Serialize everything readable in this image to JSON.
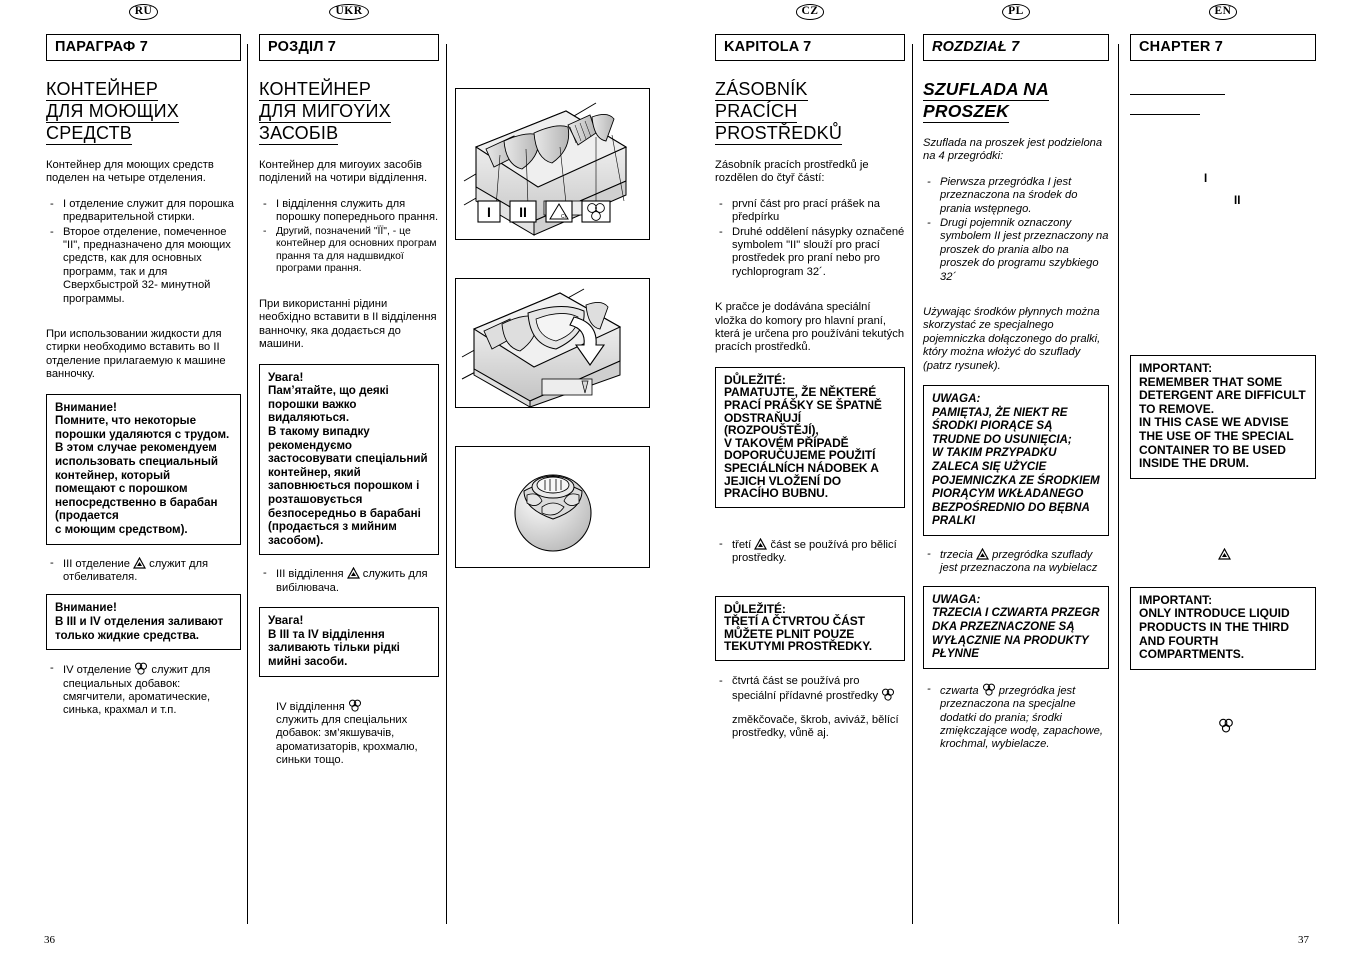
{
  "page": {
    "left_number": "36",
    "right_number": "37"
  },
  "columns": {
    "ru": {
      "flag": "RU",
      "chapter": "ПАРАГРАФ 7",
      "title_lines": [
        "КОНТЕЙНЕР",
        "ДЛЯ МОЮЩИХ",
        "СРЕДСТВ"
      ],
      "intro": "Контейнер для моющих средств поделен на четыре отделения.",
      "bullets": [
        "I отделение служит для порошка предварительной стирки.",
        "Второе отделение, помеченное \"II\", предназначено для моющих средств, как для основных программ, так и для Сверхбыстрой 32- минутной программы."
      ],
      "liquid_note": "При использовании жидкости для стирки необходимо вставить во II отделение прилагаемую к машине ванночку.",
      "warning1": "Внимание!\nПомните, что некоторые порошки удаляются с трудом.\nВ этом случае рекомендуем использовать специальный контейнер, который помещают с  порошком непосредственно в барабан (продается\nс моющим средством).",
      "bleach_bullet_pre": "III отделение",
      "bleach_bullet_post": "служит для отбеливателя.",
      "warning2": "Внимание!\nВ III и IV отделения заливают только жидкие средства.",
      "softener_bullet_pre": "IV отделение",
      "softener_bullet_post": "служит для специальных добавок: смягчители, ароматические, синька, крахмал и т.п."
    },
    "ukr": {
      "flag": "UKR",
      "chapter": "РОЗДІЛ 7",
      "title_lines": [
        "КОНТЕЙНЕР",
        "ДЛЯ МИГОYИХ",
        "ЗАСОБІВ"
      ],
      "intro": "Контейнер для мигоуих засобів поділений на чотири відділення.",
      "bullets": [
        "I відділення служить для порошку попереднього прання.",
        "Другий, позначений \"ÏÏ\", - це контейнер для основних програм прання та для надшвидкої програми прання."
      ],
      "liquid_note": "При використанні рідини необхідно вставити в II відділення ванночку, яка додається до машини.",
      "warning1": "Увага!\nПам’ятайте, що деякі порошки важко видаляються.\nВ такому випадку рекомендуємо застосовувати спеціальний контейнер, який заповнюється порошком і розташовується безпосередньо в барабані (продається з мийним засобом).",
      "bleach_bullet_pre": "III відділення",
      "bleach_bullet_post": "служить для вибілювача.",
      "warning2": "Увага!\nВ III та IV відділення заливають тільки рідкі мийні засоби.",
      "softener_bullet_pre": "IV відділення",
      "softener_bullet_post": "служить для спеціальних добавок: зм’якшувачів, ароматизаторів, крохмалю, синьки тощо."
    },
    "cz": {
      "flag": "CZ",
      "chapter": "KAPITOLA 7",
      "title_lines": [
        "ZÁSOBNÍK",
        "PRACÍCH",
        "PROSTŘEDKŮ"
      ],
      "intro": "Zásobník pracích prostředků je rozdělen do čtyř částí:",
      "bullets": [
        "první část pro prací prášek na předpírku",
        "Druhé oddělení násypky označené symbolem \"II\" slouží pro prací prostředek pro praní nebo pro rychloprogram 32´."
      ],
      "liquid_note": "K pračce je dodávána speciální vložka do komory pro hlavní praní, která je určena pro používáni tekutých pracích prostředků.",
      "warning1": "DŮLEŽITÉ:\nPAMATUJTE, ŽE NĚKTERÉ PRACÍ PRÁŠKY SE ŠPATNĚ ODSTRAŇUJÍ (ROZPOUŠTĚJÍ),\nV TAKOVÉM PŘÍPADĚ DOPORUČUJEME POUŽITÍ SPECIÁLNÍCH NÁDOBEK A JEJICH VLOŽENÍ DO PRACÍHO BUBNU.",
      "bleach_bullet_pre": "třetí",
      "bleach_bullet_post": "část se používá pro bělicí prostředky.",
      "warning2": "DŮLEŽITÉ:\nTŘETÍ A ČTVRTOU ČÁST MŮŽETE PLNIT POUZE TEKUTYMI PROSTŘEDKY.",
      "softener_bullet_pre": "čtvrtá část se používá pro speciální přídavné prostředky",
      "softener_bullet_post": "změkčovače, škrob, aviváž, bělící prostředky, vůně aj."
    },
    "pl": {
      "flag": "PL",
      "chapter": "ROZDZIAŁ 7",
      "title_lines": [
        "SZUFLADA NA",
        "PROSZEK"
      ],
      "intro": "Szuflada na proszek jest podzielona na 4 przegródki:",
      "bullets": [
        "Pierwsza przegródka I jest przeznaczona na środek do prania wstępnego.",
        "Drugi pojemnik oznaczony symbolem II jest przeznaczony na proszek do prania albo na proszek do programu szybkiego 32´"
      ],
      "liquid_note": "Używając środków płynnych można skorzystać ze specjalnego pojemniczka dołączonego do pralki, który można włożyć do szuflady (patrz rysunek).",
      "warning1": "UWAGA:\nPAMIĘTAJ, ŻE NIEKT   RE ŚRODKI PIORĄCE SĄ TRUDNE DO USUNIĘCIA;\nW TAKIM PRZYPADKU ZALECA SIĘ UŻYCIE POJEMNICZKA ZE ŚRODKIEM PIORĄCYM WKŁADANEGO BEZPOŚREDNIO DO BĘBNA PRALKI",
      "bleach_bullet_pre": "trzecia",
      "bleach_bullet_post": "przegródka szuflady jest przeznaczona na wybielacz",
      "warning2": "UWAGA:\nTRZECIA I CZWARTA PRZEGR   DKA PRZEZNACZONE SĄ WYŁĄCZNIE NA PRODUKTY PŁYNNE",
      "softener_bullet_pre": "czwarta",
      "softener_bullet_post": "przegródka jest przeznaczona na specjalne dodatki do prania; środki zmiękczające wodę, zapachowe, krochmal, wybielacze."
    },
    "en": {
      "flag": "EN",
      "chapter": "CHAPTER 7",
      "title_lines": [
        "",
        ""
      ],
      "marker_one": "I",
      "marker_two": "II",
      "warning1": "IMPORTANT:\nREMEMBER THAT SOME DETERGENT ARE DIFFICULT TO REMOVE.\nIN THIS CASE WE ADVISE THE USE OF THE SPECIAL CONTAINER TO BE USED INSIDE THE DRUM.",
      "warning2": "IMPORTANT:\nONLY INTRODUCE LIQUID PRODUCTS IN THE THIRD AND FOURTH COMPARTMENTS."
    }
  },
  "figures": {
    "drawer_open": {
      "label_one": "I",
      "label_two": "II",
      "label_bleach": "Cl",
      "icon_bleach": "bleach-triangle-icon",
      "icon_softener": "softener-flower-icon"
    },
    "drawer_insert": {
      "icon": "liquid-insert-arrow-icon"
    },
    "drum_ball": {
      "icon": "drum-dosing-ball-icon"
    }
  }
}
